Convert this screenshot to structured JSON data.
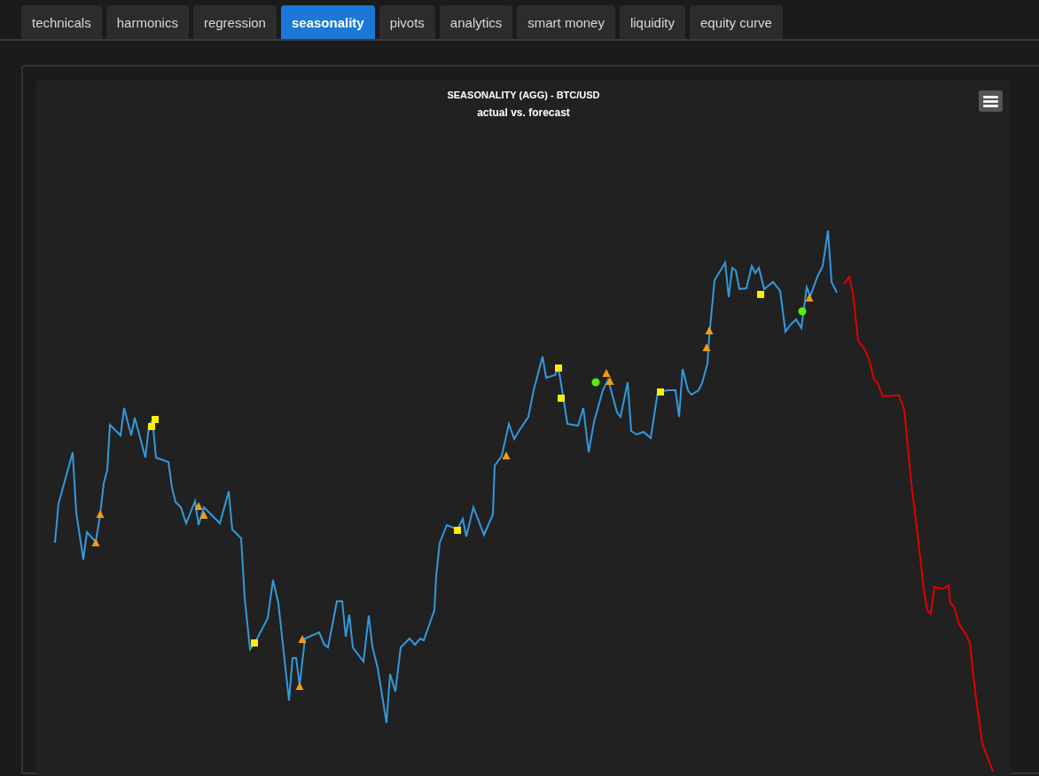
{
  "tabs": [
    {
      "label": "technicals",
      "selected": false
    },
    {
      "label": "harmonics",
      "selected": false
    },
    {
      "label": "regression",
      "selected": false
    },
    {
      "label": "seasonality",
      "selected": true
    },
    {
      "label": "pivots",
      "selected": false
    },
    {
      "label": "analytics",
      "selected": false
    },
    {
      "label": "smart money",
      "selected": false
    },
    {
      "label": "liquidity",
      "selected": false
    },
    {
      "label": "equity curve",
      "selected": false
    }
  ],
  "chart": {
    "title": "SEASONALITY (AGG) - BTC/USD",
    "subtitle": "actual vs. forecast"
  }
}
